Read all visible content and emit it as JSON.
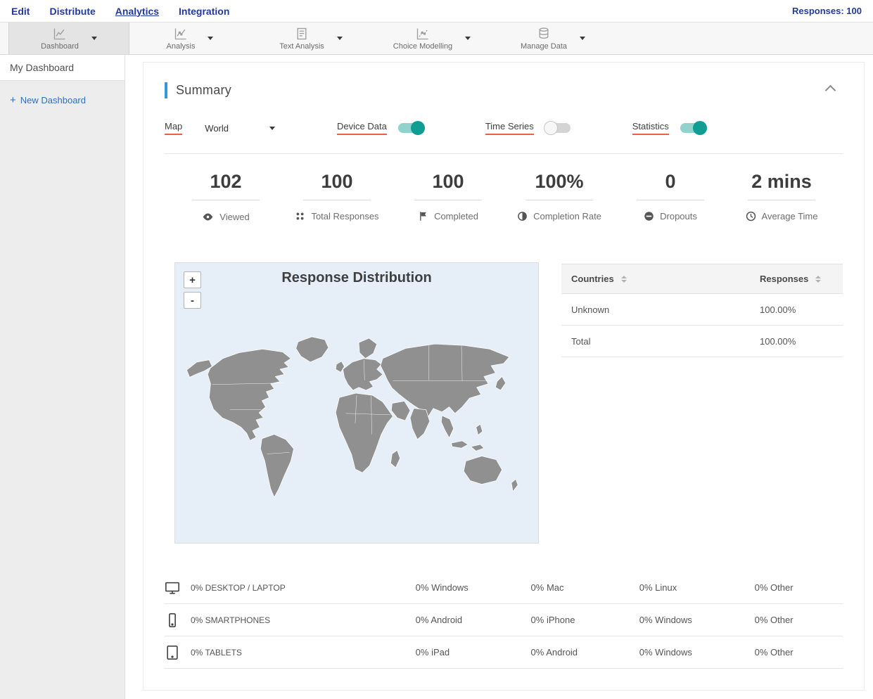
{
  "nav": {
    "items": [
      "Edit",
      "Distribute",
      "Analytics",
      "Integration"
    ],
    "responses_label": "Responses: 100"
  },
  "toolbar": {
    "items": [
      {
        "label": "Dashboard",
        "icon": "line-chart-icon"
      },
      {
        "label": "Analysis",
        "icon": "line-chart-icon"
      },
      {
        "label": "Text Analysis",
        "icon": "document-icon"
      },
      {
        "label": "Choice Modelling",
        "icon": "scatter-chart-icon"
      },
      {
        "label": "Manage Data",
        "icon": "database-icon"
      }
    ]
  },
  "sidebar": {
    "items": [
      {
        "label": "My Dashboard"
      }
    ],
    "new_dashboard": {
      "plus": "+",
      "label": "New Dashboard"
    }
  },
  "summary": {
    "title": "Summary",
    "controls": {
      "map_label": "Map",
      "map_value": "World",
      "device_data_label": "Device Data",
      "device_data_on": true,
      "time_series_label": "Time Series",
      "time_series_on": false,
      "statistics_label": "Statistics",
      "statistics_on": true
    },
    "stats": [
      {
        "value": "102",
        "label": "Viewed",
        "icon": "eye-icon"
      },
      {
        "value": "100",
        "label": "Total Responses",
        "icon": "dots-icon"
      },
      {
        "value": "100",
        "label": "Completed",
        "icon": "flag-icon"
      },
      {
        "value": "100%",
        "label": "Completion Rate",
        "icon": "half-circle-icon"
      },
      {
        "value": "0",
        "label": "Dropouts",
        "icon": "minus-circle-icon"
      },
      {
        "value": "2 mins",
        "label": "Average Time",
        "icon": "clock-icon"
      }
    ],
    "map": {
      "title": "Response Distribution",
      "zoom_in": "+",
      "zoom_out": "-"
    },
    "countries_table": {
      "headers": [
        "Countries",
        "Responses"
      ],
      "rows": [
        {
          "country": "Unknown",
          "responses": "100.00%"
        },
        {
          "country": "Total",
          "responses": "100.00%"
        }
      ]
    },
    "device_table": {
      "rows": [
        {
          "icon": "desktop-icon",
          "label": "0% DESKTOP / LAPTOP",
          "cols": [
            "0% Windows",
            "0% Mac",
            "0% Linux",
            "0% Other"
          ]
        },
        {
          "icon": "smartphone-icon",
          "label": "0% SMARTPHONES",
          "cols": [
            "0% Android",
            "0% iPhone",
            "0% Windows",
            "0% Other"
          ]
        },
        {
          "icon": "tablet-icon",
          "label": "0% TABLETS",
          "cols": [
            "0% iPad",
            "0% Android",
            "0% Windows",
            "0% Other"
          ]
        }
      ]
    }
  },
  "colors": {
    "nav_blue": "#23399f",
    "accent_blue": "#2e9bd6",
    "underline_red": "#ee5f4b",
    "toggle_on": "#0f9d94",
    "map_land": "#909090",
    "map_ocean": "#e6eff7"
  }
}
